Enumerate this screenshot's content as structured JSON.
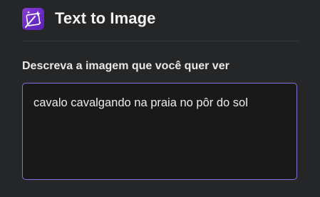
{
  "header": {
    "icon": "magic-image-icon",
    "title": "Text to Image"
  },
  "prompt": {
    "label": "Descreva a imagem que você quer ver",
    "value": "cavalo cavalgando na praia no pôr do sol"
  },
  "colors": {
    "background": "#252627",
    "accent_border": "#8b6fd8",
    "icon_purple": "#7a35cc",
    "input_background": "#19191a"
  }
}
